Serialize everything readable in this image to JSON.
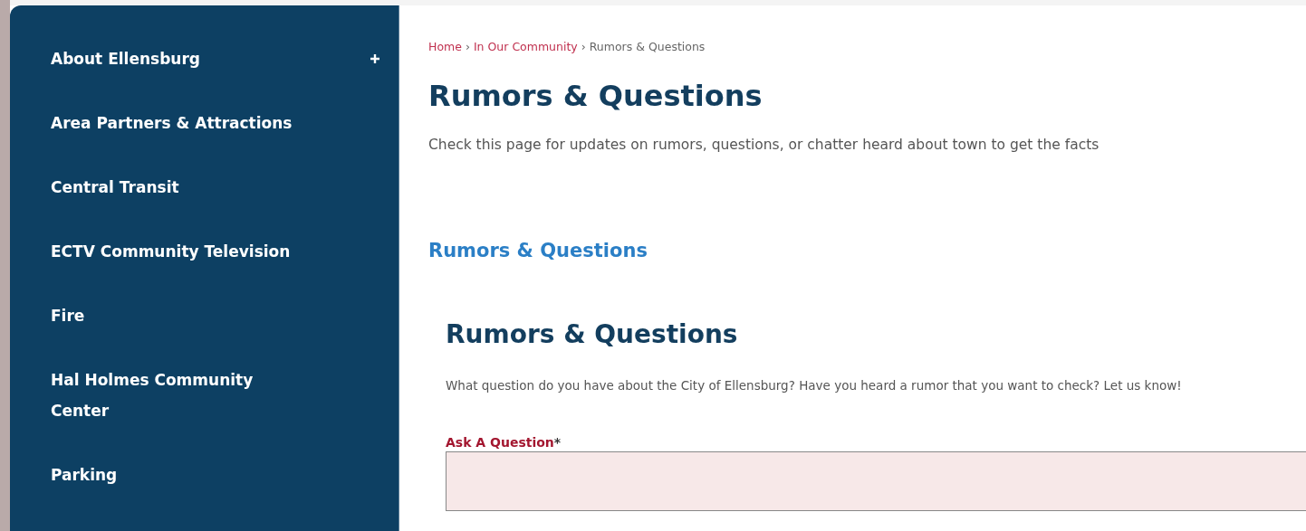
{
  "sidebar": {
    "items": [
      {
        "label": "About Ellensburg",
        "expanded": false
      },
      {
        "label": "Area Partners & Attractions"
      },
      {
        "label": "Central Transit"
      },
      {
        "label": "ECTV Community Television"
      },
      {
        "label": "Fire"
      },
      {
        "label": "Hal Holmes Community Center"
      },
      {
        "label": "Parking"
      }
    ]
  },
  "breadcrumb": [
    {
      "label": "Home",
      "kind": "link"
    },
    {
      "label": "›",
      "kind": "separator"
    },
    {
      "label": "In Our Community",
      "kind": "link"
    },
    {
      "label": "›",
      "kind": "separator"
    },
    {
      "label": "Rumors & Questions",
      "kind": "current"
    }
  ],
  "page_title": "Rumors & Questions",
  "intro": "Check this page for updates on rumors, questions, or chatter heard about town to get the facts",
  "section_link": "Rumors & Questions",
  "form": {
    "title": "Rumors & Questions",
    "description": "What question do you have about the City of Ellensburg? Have you heard a rumor that you want to check? Let us know!",
    "fields": [
      {
        "label": "Ask A Question",
        "required": true,
        "required_mark": "*"
      }
    ]
  }
}
